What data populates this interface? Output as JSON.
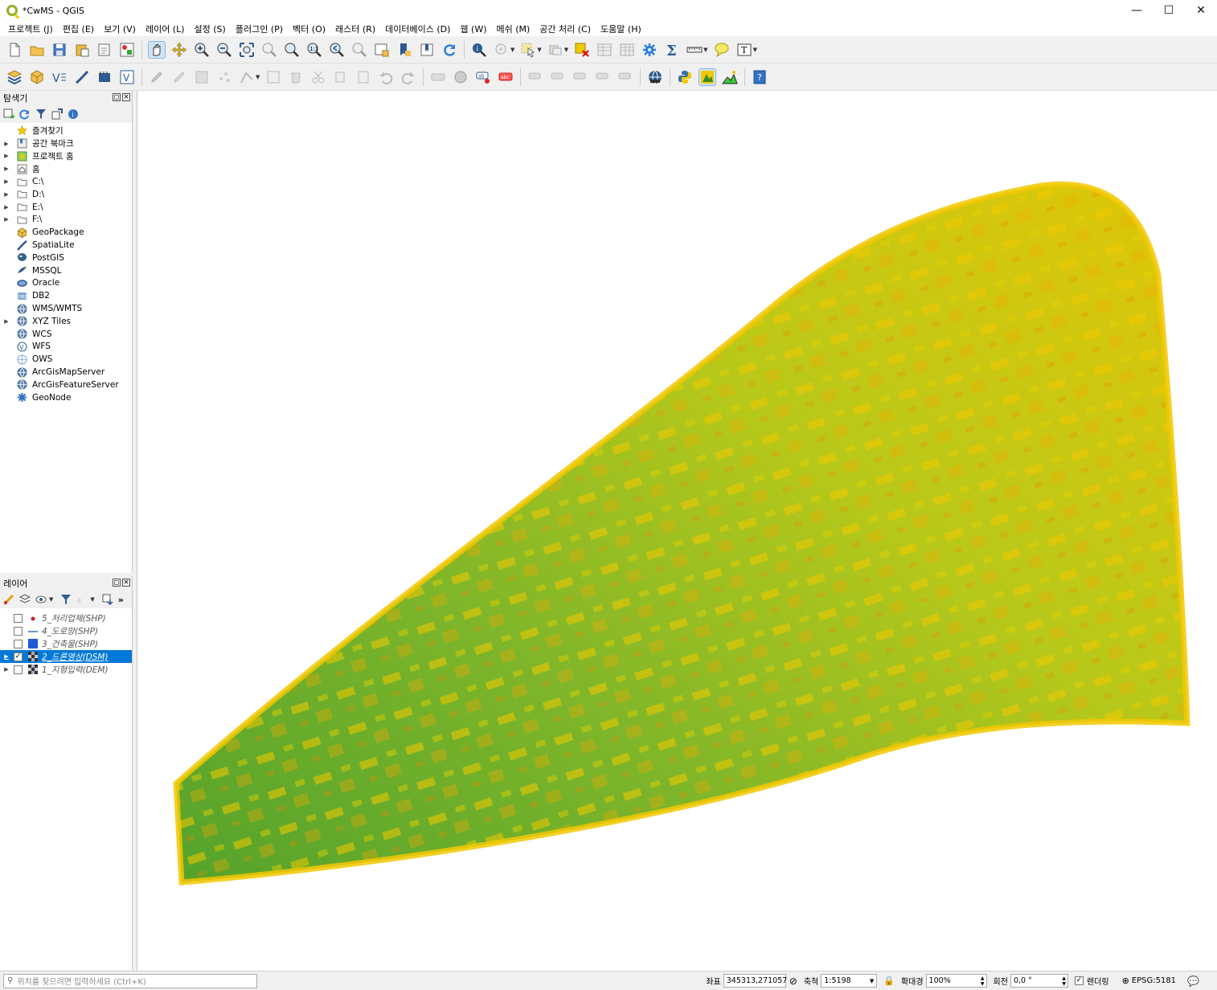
{
  "window": {
    "title": "*CwMS - QGIS",
    "minimize": "—",
    "maximize": "☐",
    "close": "✕"
  },
  "menu": [
    "프로젝트 (J)",
    "편집 (E)",
    "보기 (V)",
    "레이어 (L)",
    "설정 (S)",
    "플러그인 (P)",
    "벡터 (O)",
    "래스터 (R)",
    "데이터베이스 (D)",
    "웹 (W)",
    "메쉬 (M)",
    "공간 처리 (C)",
    "도움말 (H)"
  ],
  "browser": {
    "title": "탐색기",
    "items": [
      {
        "label": "즐겨찾기",
        "icon": "star-icon",
        "expandable": false
      },
      {
        "label": "공간 북마크",
        "icon": "bookmark-icon",
        "expandable": true
      },
      {
        "label": "프로젝트 홈",
        "icon": "project-home-icon",
        "expandable": true
      },
      {
        "label": "홈",
        "icon": "home-icon",
        "expandable": true
      },
      {
        "label": "C:\\",
        "icon": "folder-icon",
        "expandable": true
      },
      {
        "label": "D:\\",
        "icon": "folder-icon",
        "expandable": true
      },
      {
        "label": "E:\\",
        "icon": "folder-icon",
        "expandable": true
      },
      {
        "label": "F:\\",
        "icon": "folder-icon",
        "expandable": true
      },
      {
        "label": "GeoPackage",
        "icon": "geopackage-icon",
        "expandable": false
      },
      {
        "label": "SpatiaLite",
        "icon": "spatialite-icon",
        "expandable": false
      },
      {
        "label": "PostGIS",
        "icon": "postgis-icon",
        "expandable": false
      },
      {
        "label": "MSSQL",
        "icon": "mssql-icon",
        "expandable": false
      },
      {
        "label": "Oracle",
        "icon": "oracle-icon",
        "expandable": false
      },
      {
        "label": "DB2",
        "icon": "db2-icon",
        "expandable": false
      },
      {
        "label": "WMS/WMTS",
        "icon": "globe-icon",
        "expandable": false
      },
      {
        "label": "XYZ Tiles",
        "icon": "globe-icon",
        "expandable": true
      },
      {
        "label": "WCS",
        "icon": "globe-icon",
        "expandable": false
      },
      {
        "label": "WFS",
        "icon": "wfs-icon",
        "expandable": false
      },
      {
        "label": "OWS",
        "icon": "ows-icon",
        "expandable": false
      },
      {
        "label": "ArcGisMapServer",
        "icon": "globe-icon",
        "expandable": false
      },
      {
        "label": "ArcGisFeatureServer",
        "icon": "globe-icon",
        "expandable": false
      },
      {
        "label": "GeoNode",
        "icon": "geonode-icon",
        "expandable": false
      }
    ]
  },
  "layers": {
    "title": "레이어",
    "items": [
      {
        "label": "5_처리업체(SHP)",
        "checked": false,
        "selected": false,
        "symbol": "point",
        "color": "#d0202a"
      },
      {
        "label": "4_도로망(SHP)",
        "checked": false,
        "selected": false,
        "symbol": "line",
        "color": "#3b6fb6"
      },
      {
        "label": "3_건축물(SHP)",
        "checked": false,
        "selected": false,
        "symbol": "polygon",
        "color": "#1f5bd6"
      },
      {
        "label": "2_드론영상(DSM)",
        "checked": true,
        "selected": true,
        "symbol": "raster",
        "color": "#333333"
      },
      {
        "label": "1_지형입력(DEM)",
        "checked": false,
        "selected": false,
        "symbol": "raster",
        "color": "#333333"
      }
    ]
  },
  "status": {
    "locator_placeholder": "위치를 찾으려면 입력하세요 (Ctrl+K)",
    "coord_label": "좌표",
    "coord_value": "345313,271057",
    "scale_label": "축척",
    "scale_value": "1:5198",
    "magnifier_label": "확대경",
    "magnifier_value": "100%",
    "rotation_label": "회전",
    "rotation_value": "0,0 °",
    "render_label": "렌더링",
    "crs": "EPSG:5181"
  },
  "colors": {
    "raster_low": "#4a9e2c",
    "raster_mid": "#b6c81a",
    "raster_high": "#f2c800",
    "raster_peak": "#f08a00",
    "selection": "#0078d7"
  }
}
